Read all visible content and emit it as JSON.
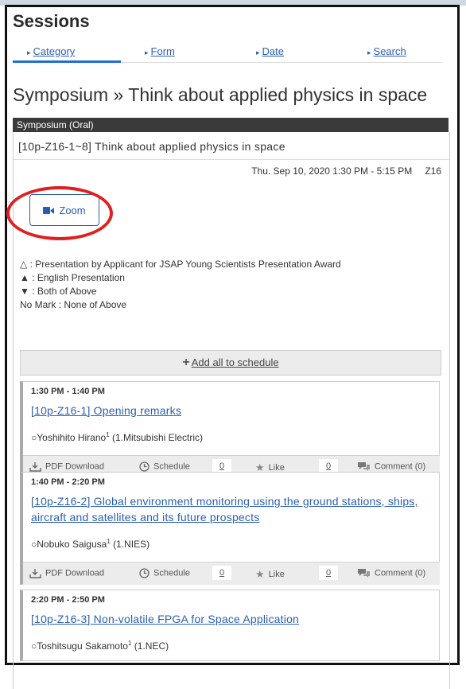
{
  "header": {
    "title": "Sessions",
    "tabs": [
      {
        "label": "Category"
      },
      {
        "label": "Form"
      },
      {
        "label": "Date"
      },
      {
        "label": "Search"
      }
    ]
  },
  "page_heading": "Symposium » Think about applied physics in space",
  "session": {
    "type_label": "Symposium (Oral)",
    "code_title": "[10p-Z16-1~8] Think about applied physics in space",
    "datetime": "Thu. Sep 10, 2020 1:30 PM - 5:15 PM",
    "room": "Z16",
    "zoom_label": "Zoom"
  },
  "legend": [
    "△ : Presentation by Applicant for JSAP Young Scientists Presentation Award",
    "▲ : English Presentation",
    "▼ : Both of Above",
    "No Mark : None of Above"
  ],
  "add_all_label": "Add all to schedule",
  "talks": [
    {
      "time": "1:30 PM - 1:40 PM",
      "title": "[10p-Z16-1] Opening remarks",
      "author": "○Yoshihito Hirano",
      "sup": "1",
      "affil": " (1.Mitsubishi Electric)"
    },
    {
      "time": "1:40 PM - 2:20 PM",
      "title": "[10p-Z16-2] Global environment monitoring using the ground stations, ships, aircraft and satellites and its future prospects",
      "author": "○Nobuko Saigusa",
      "sup": "1",
      "affil": " (1.NIES)"
    },
    {
      "time": "2:20 PM - 2:50 PM",
      "title": "[10p-Z16-3] Non-volatile FPGA for Space Application",
      "author": "○Toshitsugu Sakamoto",
      "sup": "1",
      "affil": " (1.NEC)"
    }
  ],
  "actions": {
    "pdf": "PDF Download",
    "schedule": "Schedule",
    "schedule_count": "0",
    "like": "Like",
    "like_count": "0",
    "comment": "Comment (0)"
  },
  "colors": {
    "link": "#2b5fb3",
    "accent": "#1f6fd1",
    "highlight_ring": "#e02020",
    "dark_bar": "#3a3a3a"
  }
}
